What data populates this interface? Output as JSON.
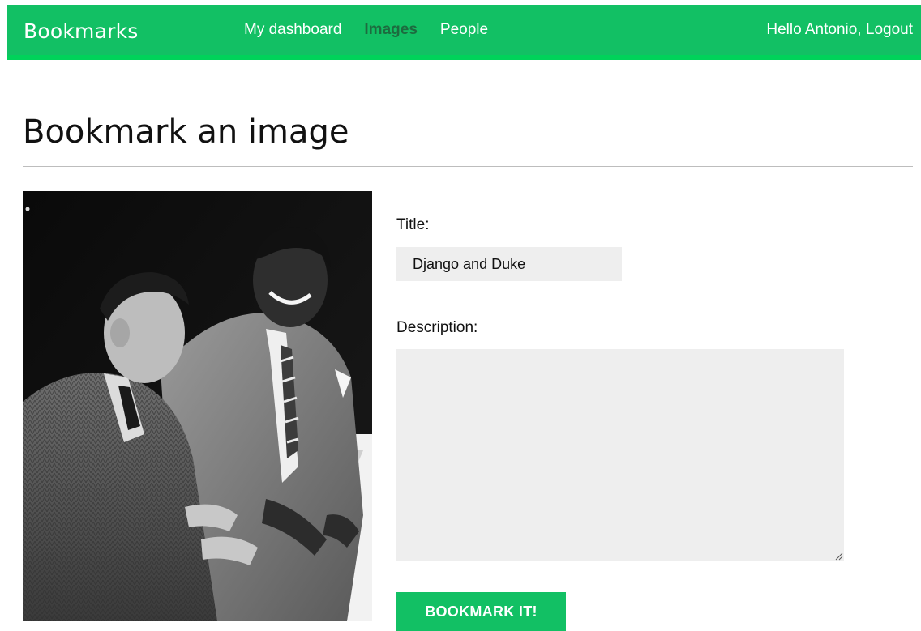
{
  "header": {
    "logo": "Bookmarks",
    "nav": [
      {
        "label": "My dashboard",
        "active": false
      },
      {
        "label": "Images",
        "active": true
      },
      {
        "label": "People",
        "active": false
      }
    ],
    "greeting": "Hello Antonio,",
    "logout_label": "Logout",
    "colors": {
      "bar": "#12c064",
      "bar_border": "#00d25a",
      "active_link": "#1d6b3f"
    }
  },
  "page": {
    "title": "Bookmark an image"
  },
  "form": {
    "title_label": "Title:",
    "title_value": "Django and Duke",
    "description_label": "Description:",
    "description_value": "",
    "submit_label": "BOOKMARK IT!"
  },
  "image": {
    "kind": "black-and-white photograph",
    "subject": "two men in suits at a piano"
  }
}
